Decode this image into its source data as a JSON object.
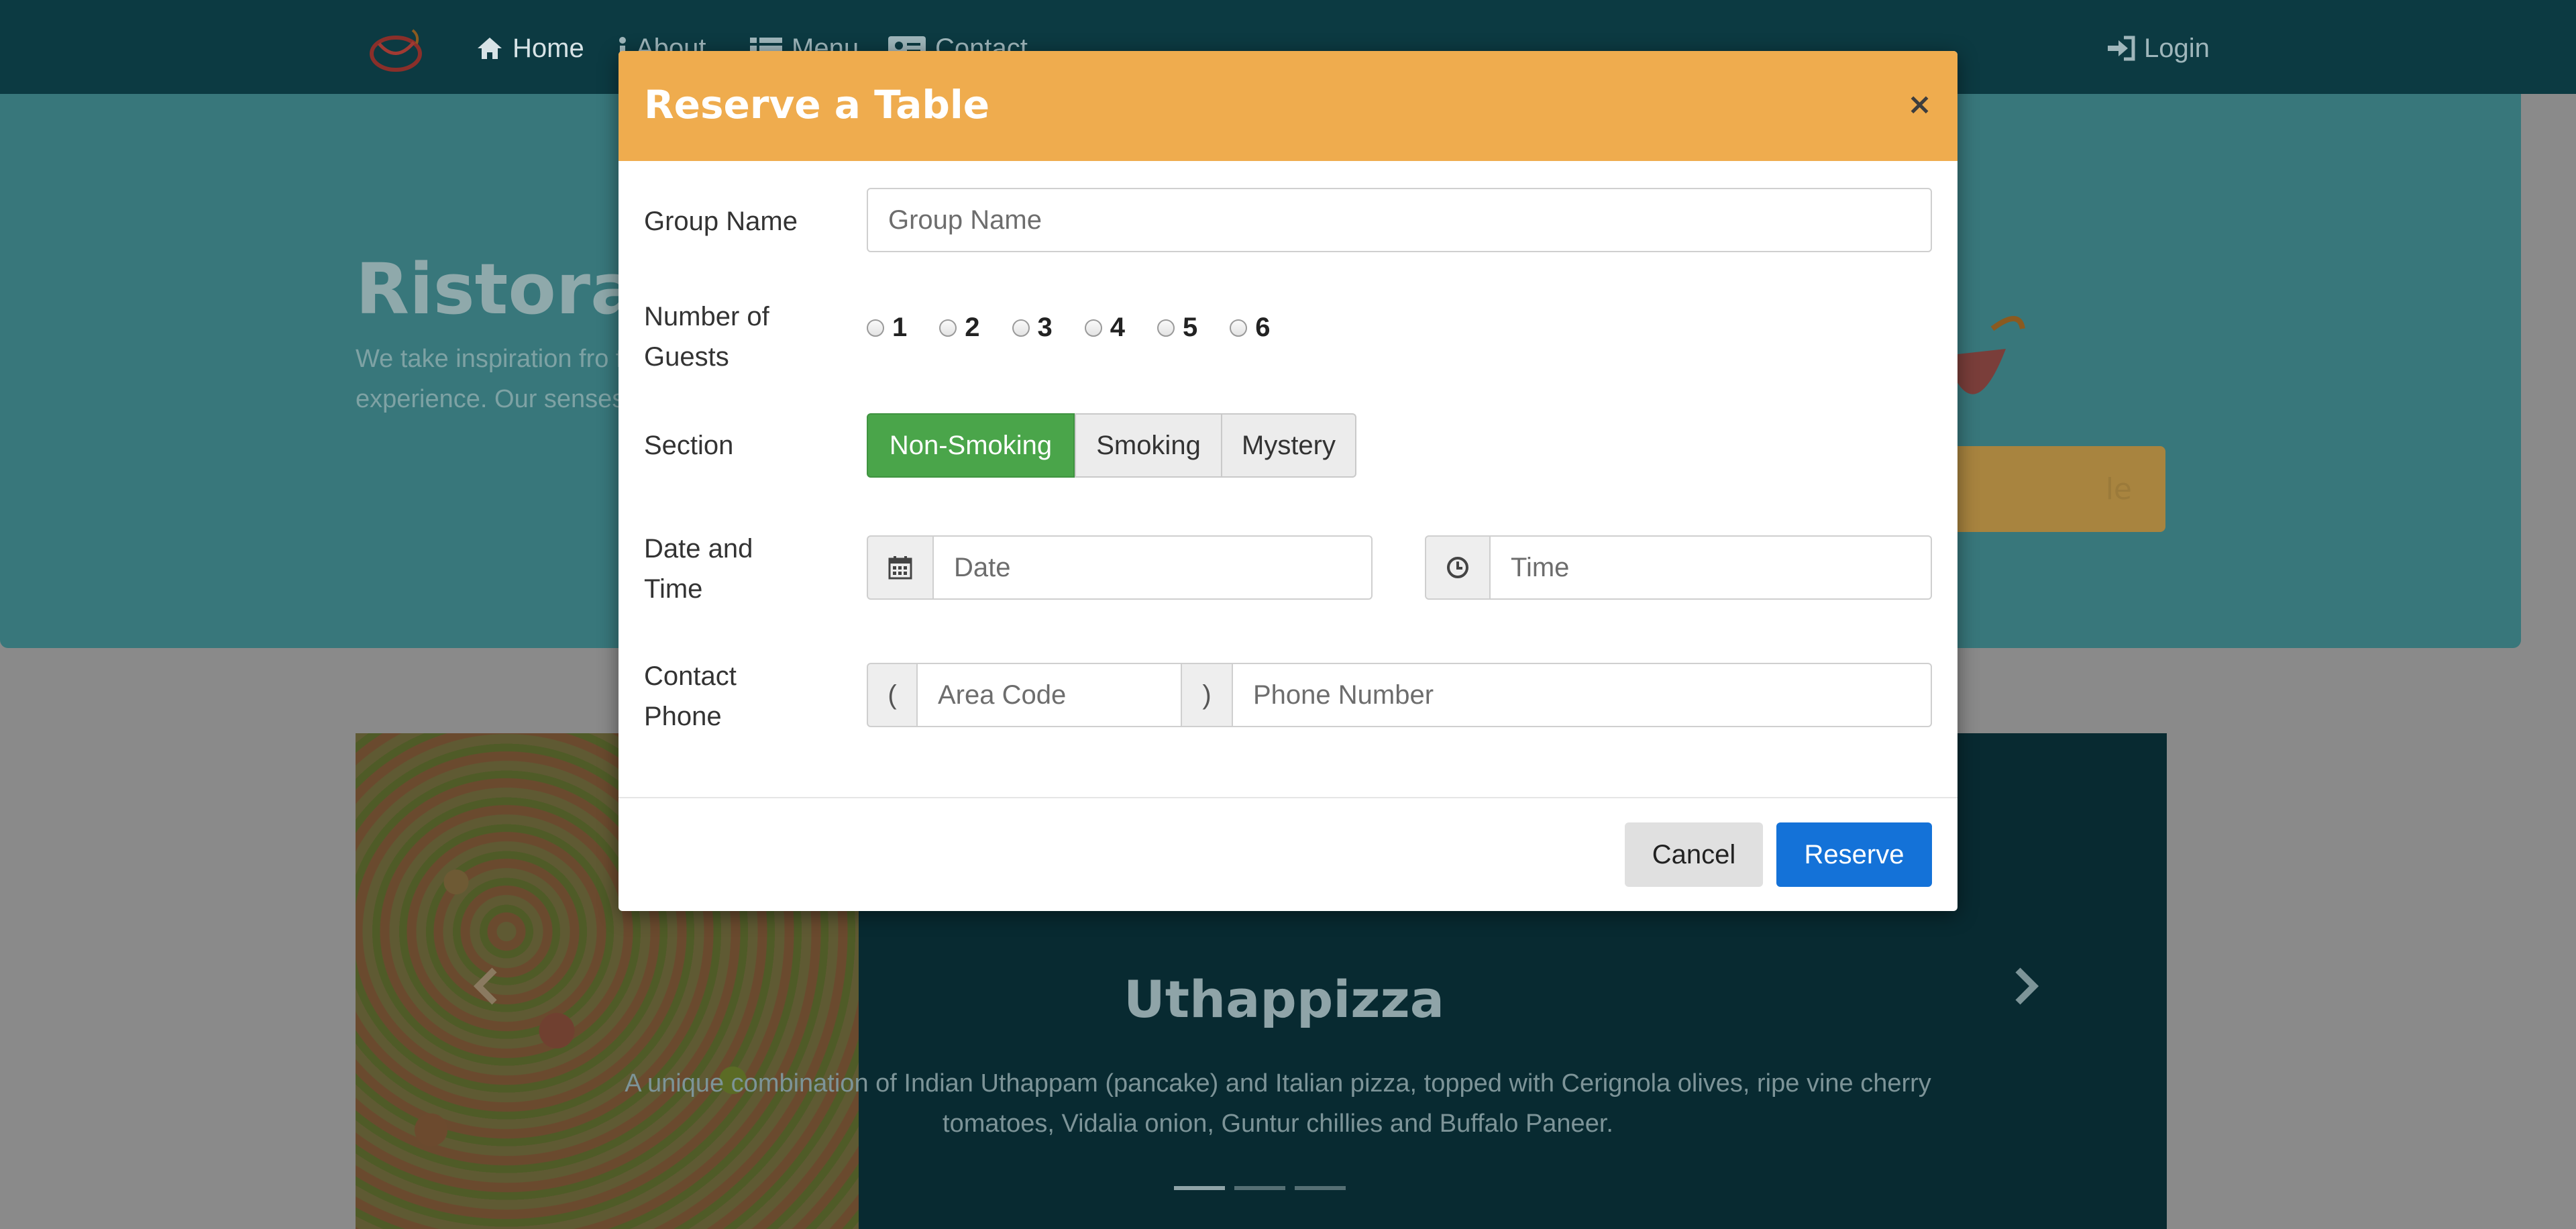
{
  "nav": {
    "home": "Home",
    "about": "About",
    "menu": "Menu",
    "contact": "Contact",
    "login": "Login"
  },
  "jumbotron": {
    "title": "Ristorant",
    "text": "We take inspiration fro fusion experience. Our senses!",
    "button_label": "le"
  },
  "carousel": {
    "title": "Uthappizza",
    "description": "A unique combination of Indian Uthappam (pancake) and Italian pizza, topped with Cerignola olives, ripe vine cherry tomatoes, Vidalia onion, Guntur chillies and Buffalo Paneer.",
    "active_index": 0
  },
  "modal": {
    "title": "Reserve a Table",
    "close": "×",
    "group_name_label": "Group Name",
    "group_name_placeholder": "Group Name",
    "guests_label_line1": "Number of",
    "guests_label_line2": "Guests",
    "guest_options": [
      "1",
      "2",
      "3",
      "4",
      "5",
      "6"
    ],
    "section_label": "Section",
    "section_options": [
      "Non-Smoking",
      "Smoking",
      "Mystery"
    ],
    "section_selected": "Non-Smoking",
    "datetime_label_line1": "Date and",
    "datetime_label_line2": "Time",
    "date_placeholder": "Date",
    "time_placeholder": "Time",
    "phone_label_line1": "Contact",
    "phone_label_line2": "Phone",
    "area_open": "(",
    "area_placeholder": "Area Code",
    "area_close": ")",
    "phone_placeholder": "Phone Number",
    "cancel_label": "Cancel",
    "reserve_label": "Reserve"
  },
  "colors": {
    "header": "#efac4e",
    "selected_section": "#4aa54a",
    "primary": "#1472d8"
  }
}
